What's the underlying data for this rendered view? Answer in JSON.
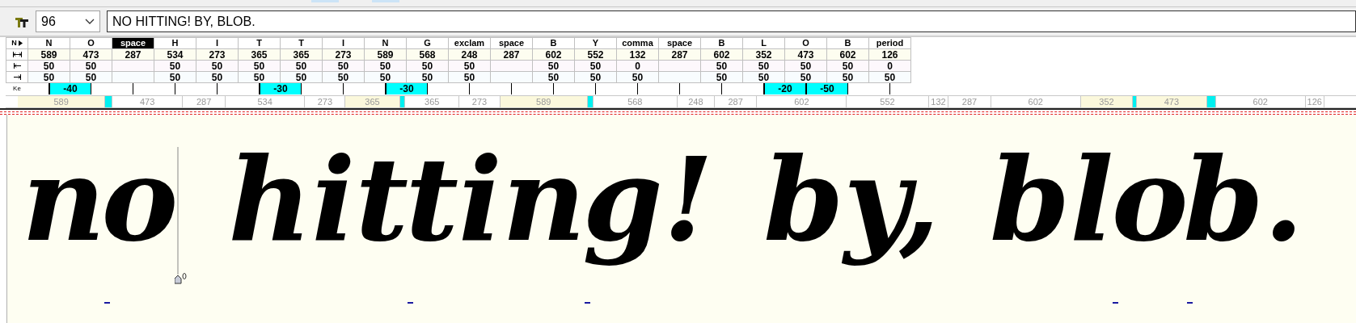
{
  "toolbar": {
    "size": "96",
    "text": "NO HITTING! BY, BLOB."
  },
  "row_header": {
    "glyph_label": "N",
    "kerning_label": "Ke"
  },
  "glyphs": [
    {
      "name": "N",
      "advance": "589",
      "lsb": "50",
      "rsb": "50",
      "selected": false,
      "kern": "-40"
    },
    {
      "name": "O",
      "advance": "473",
      "lsb": "50",
      "rsb": "50",
      "selected": false
    },
    {
      "name": "space",
      "advance": "287",
      "selected": true
    },
    {
      "name": "H",
      "advance": "534",
      "lsb": "50",
      "rsb": "50",
      "selected": false
    },
    {
      "name": "I",
      "advance": "273",
      "lsb": "50",
      "rsb": "50",
      "selected": false
    },
    {
      "name": "T",
      "advance": "365",
      "lsb": "50",
      "rsb": "50",
      "selected": false,
      "kern": "-30"
    },
    {
      "name": "T",
      "advance": "365",
      "lsb": "50",
      "rsb": "50",
      "selected": false
    },
    {
      "name": "I",
      "advance": "273",
      "lsb": "50",
      "rsb": "50",
      "selected": false
    },
    {
      "name": "N",
      "advance": "589",
      "lsb": "50",
      "rsb": "50",
      "selected": false,
      "kern": "-30"
    },
    {
      "name": "G",
      "advance": "568",
      "lsb": "50",
      "rsb": "50",
      "selected": false
    },
    {
      "name": "exclam",
      "advance": "248",
      "lsb": "50",
      "rsb": "50",
      "selected": false
    },
    {
      "name": "space",
      "advance": "287",
      "selected": false
    },
    {
      "name": "B",
      "advance": "602",
      "lsb": "50",
      "rsb": "50",
      "selected": false
    },
    {
      "name": "Y",
      "advance": "552",
      "lsb": "50",
      "rsb": "50",
      "selected": false
    },
    {
      "name": "comma",
      "advance": "132",
      "lsb": "0",
      "rsb": "50",
      "selected": false
    },
    {
      "name": "space",
      "advance": "287",
      "selected": false
    },
    {
      "name": "B",
      "advance": "602",
      "lsb": "50",
      "rsb": "50",
      "selected": false
    },
    {
      "name": "L",
      "advance": "352",
      "lsb": "50",
      "rsb": "50",
      "selected": false,
      "kern": "-20"
    },
    {
      "name": "O",
      "advance": "473",
      "lsb": "50",
      "rsb": "50",
      "selected": false,
      "kern": "-50"
    },
    {
      "name": "B",
      "advance": "602",
      "lsb": "50",
      "rsb": "50",
      "selected": false
    },
    {
      "name": "period",
      "advance": "126",
      "lsb": "0",
      "rsb": "50",
      "selected": false
    }
  ],
  "ruler": [
    {
      "label": "589",
      "kerned": true
    },
    {
      "label": "473",
      "kerned": false
    },
    {
      "label": "287",
      "kerned": false
    },
    {
      "label": "534",
      "kerned": false
    },
    {
      "label": "273",
      "kerned": false
    },
    {
      "label": "365",
      "kerned": true
    },
    {
      "label": "365",
      "kerned": false
    },
    {
      "label": "273",
      "kerned": false
    },
    {
      "label": "589",
      "kerned": true
    },
    {
      "label": "568",
      "kerned": false
    },
    {
      "label": "248",
      "kerned": false
    },
    {
      "label": "287",
      "kerned": false
    },
    {
      "label": "602",
      "kerned": false
    },
    {
      "label": "552",
      "kerned": false
    },
    {
      "label": "132",
      "kerned": false
    },
    {
      "label": "287",
      "kerned": false
    },
    {
      "label": "602",
      "kerned": false
    },
    {
      "label": "352",
      "kerned": true
    },
    {
      "label": "473",
      "kerned": true
    },
    {
      "label": "602",
      "kerned": false
    },
    {
      "label": "126",
      "kerned": false
    }
  ],
  "preview": {
    "words": [
      "no",
      "hitting!",
      "by,",
      "blob."
    ]
  }
}
